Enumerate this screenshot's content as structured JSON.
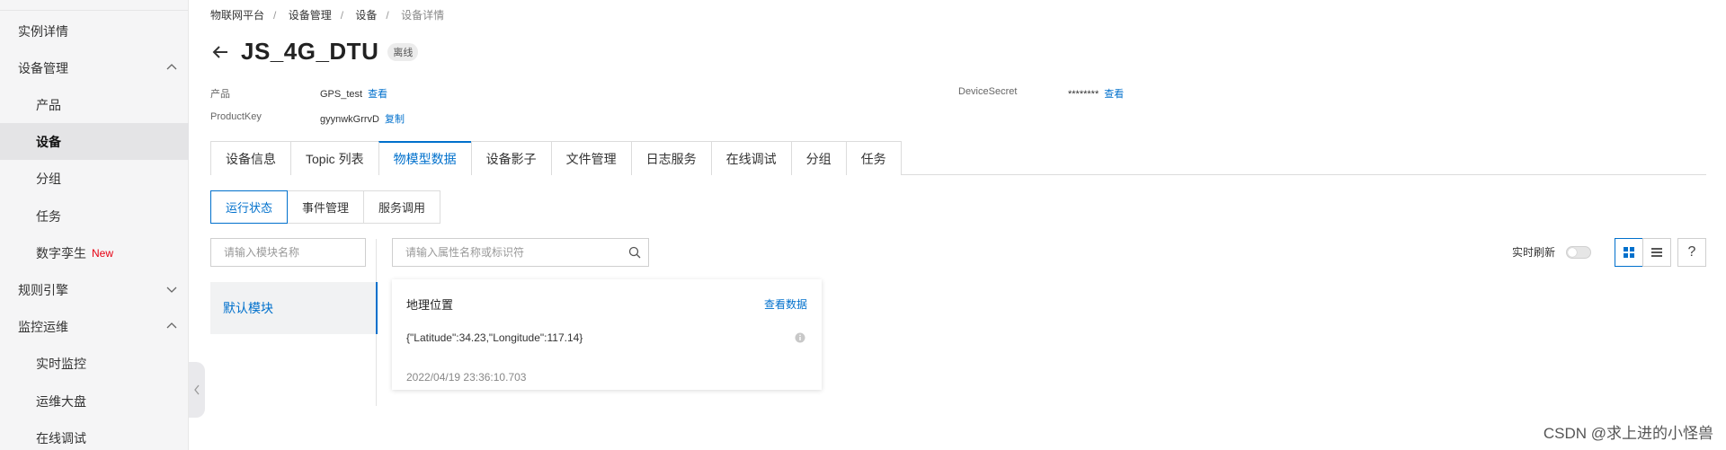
{
  "sidebar": {
    "items": [
      {
        "label": "实例详情",
        "level": 1
      },
      {
        "label": "设备管理",
        "level": 1,
        "chevron": "chevron-up-icon"
      },
      {
        "label": "产品",
        "level": 2
      },
      {
        "label": "设备",
        "level": 2,
        "active": true
      },
      {
        "label": "分组",
        "level": 2
      },
      {
        "label": "任务",
        "level": 2
      },
      {
        "label": "数字孪生",
        "level": 2,
        "badge": "New"
      },
      {
        "label": "规则引擎",
        "level": 1,
        "chevron": "chevron-down-icon"
      },
      {
        "label": "监控运维",
        "level": 1,
        "chevron": "chevron-up-icon"
      },
      {
        "label": "实时监控",
        "level": 2
      },
      {
        "label": "运维大盘",
        "level": 2
      },
      {
        "label": "在线调试",
        "level": 2
      }
    ]
  },
  "breadcrumb": [
    "物联网平台",
    "设备管理",
    "设备",
    "设备详情"
  ],
  "breadcrumb_sep": "/",
  "header": {
    "title": "JS_4G_DTU",
    "status": "离线"
  },
  "info": {
    "product_label": "产品",
    "product_value": "GPS_test",
    "product_link": "查看",
    "productkey_label": "ProductKey",
    "productkey_value": "gyynwkGrrvD",
    "productkey_link": "复制",
    "secret_label": "DeviceSecret",
    "secret_value": "********",
    "secret_link": "查看"
  },
  "tabs": [
    "设备信息",
    "Topic 列表",
    "物模型数据",
    "设备影子",
    "文件管理",
    "日志服务",
    "在线调试",
    "分组",
    "任务"
  ],
  "active_tab": 2,
  "subtabs": [
    "运行状态",
    "事件管理",
    "服务调用"
  ],
  "active_subtab": 0,
  "module_search": {
    "placeholder": "请输入模块名称"
  },
  "property_search": {
    "placeholder": "请输入属性名称或标识符"
  },
  "modules": [
    {
      "label": "默认模块"
    }
  ],
  "realtime_label": "实时刷新",
  "realtime_on": false,
  "help_label": "?",
  "property_card": {
    "name": "地理位置",
    "link": "查看数据",
    "value": "{\"Latitude\":34.23,\"Longitude\":117.14}",
    "time": "2022/04/19 23:36:10.703"
  },
  "watermark": "CSDN @求上进的小怪兽",
  "colors": {
    "accent": "#0070cc",
    "sidebar_bg": "#f5f5f6",
    "new_badge": "#e60012"
  }
}
